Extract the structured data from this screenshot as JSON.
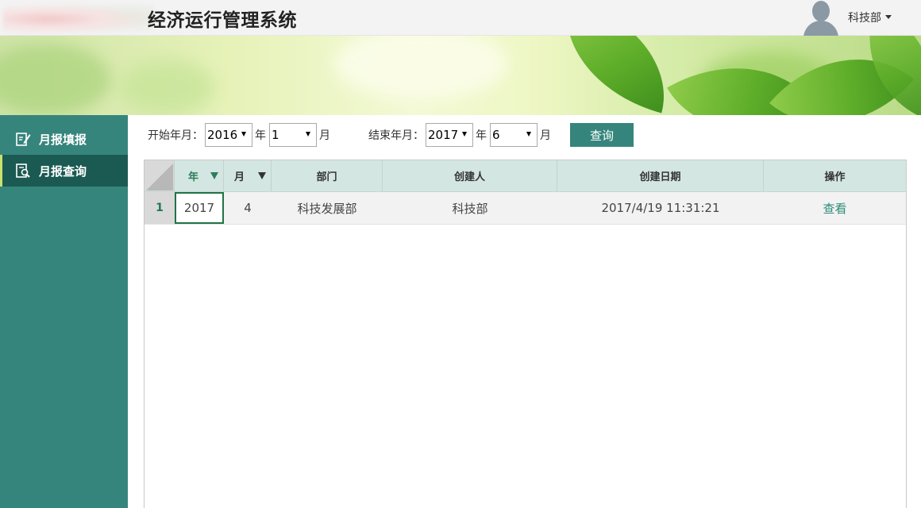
{
  "header": {
    "title": "经济运行管理系统",
    "user_label": "科技部"
  },
  "sidebar": {
    "items": [
      {
        "label": "月报填报",
        "icon": "edit-form-icon",
        "active": false
      },
      {
        "label": "月报查询",
        "icon": "search-document-icon",
        "active": true
      }
    ]
  },
  "query": {
    "start_label": "开始年月：",
    "start_year": "2016",
    "start_month": "1",
    "end_label": "结束年月：",
    "end_year": "2017",
    "end_month": "6",
    "year_unit": "年",
    "month_unit": "月",
    "button_label": "查询"
  },
  "table": {
    "headers": [
      "年",
      "月",
      "部门",
      "创建人",
      "创建日期",
      "操作"
    ],
    "sorted_column": "年",
    "rows": [
      {
        "num": "1",
        "year": "2017",
        "month": "4",
        "dept": "科技发展部",
        "creator": "科技部",
        "created": "2017/4/19 11:31:21",
        "action": "查看"
      }
    ]
  },
  "colors": {
    "sidebar": "#36857c",
    "sidebar_active": "#1b5a53",
    "accent": "#2e7d5b",
    "header_row": "#d4e6e1"
  }
}
